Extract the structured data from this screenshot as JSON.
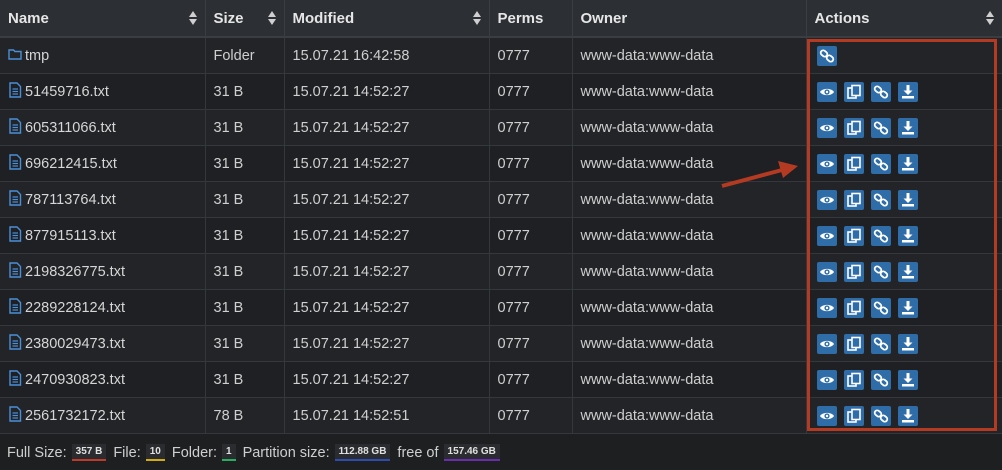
{
  "columns": [
    {
      "label": "Name"
    },
    {
      "label": "Size"
    },
    {
      "label": "Modified"
    },
    {
      "label": "Perms"
    },
    {
      "label": "Owner"
    },
    {
      "label": "Actions"
    }
  ],
  "rows": [
    {
      "name": "tmp",
      "type": "folder",
      "size": "Folder",
      "modified": "15.07.21 16:42:58",
      "perms": "0777",
      "owner": "www-data:www-data"
    },
    {
      "name": "51459716.txt",
      "type": "file",
      "size": "31 B",
      "modified": "15.07.21 14:52:27",
      "perms": "0777",
      "owner": "www-data:www-data"
    },
    {
      "name": "605311066.txt",
      "type": "file",
      "size": "31 B",
      "modified": "15.07.21 14:52:27",
      "perms": "0777",
      "owner": "www-data:www-data"
    },
    {
      "name": "696212415.txt",
      "type": "file",
      "size": "31 B",
      "modified": "15.07.21 14:52:27",
      "perms": "0777",
      "owner": "www-data:www-data"
    },
    {
      "name": "787113764.txt",
      "type": "file",
      "size": "31 B",
      "modified": "15.07.21 14:52:27",
      "perms": "0777",
      "owner": "www-data:www-data"
    },
    {
      "name": "877915113.txt",
      "type": "file",
      "size": "31 B",
      "modified": "15.07.21 14:52:27",
      "perms": "0777",
      "owner": "www-data:www-data"
    },
    {
      "name": "2198326775.txt",
      "type": "file",
      "size": "31 B",
      "modified": "15.07.21 14:52:27",
      "perms": "0777",
      "owner": "www-data:www-data"
    },
    {
      "name": "2289228124.txt",
      "type": "file",
      "size": "31 B",
      "modified": "15.07.21 14:52:27",
      "perms": "0777",
      "owner": "www-data:www-data"
    },
    {
      "name": "2380029473.txt",
      "type": "file",
      "size": "31 B",
      "modified": "15.07.21 14:52:27",
      "perms": "0777",
      "owner": "www-data:www-data"
    },
    {
      "name": "2470930823.txt",
      "type": "file",
      "size": "31 B",
      "modified": "15.07.21 14:52:27",
      "perms": "0777",
      "owner": "www-data:www-data"
    },
    {
      "name": "2561732172.txt",
      "type": "file",
      "size": "78 B",
      "modified": "15.07.21 14:52:51",
      "perms": "0777",
      "owner": "www-data:www-data"
    }
  ],
  "action_icons": {
    "folder": [
      "link-icon"
    ],
    "file": [
      "eye-icon",
      "copy-icon",
      "link-icon",
      "download-icon"
    ]
  },
  "footer": {
    "full_size_label": "Full Size:",
    "full_size_value": "357 B",
    "file_label": "File:",
    "file_value": "10",
    "folder_label": "Folder:",
    "folder_value": "1",
    "partition_label": "Partition size:",
    "partition_value": "112.88 GB",
    "free_label": "free of",
    "free_value": "157.46 GB"
  },
  "colors": {
    "background": "#1d1f21",
    "action_button": "#2f6da8",
    "annotation": "#b43a22"
  }
}
